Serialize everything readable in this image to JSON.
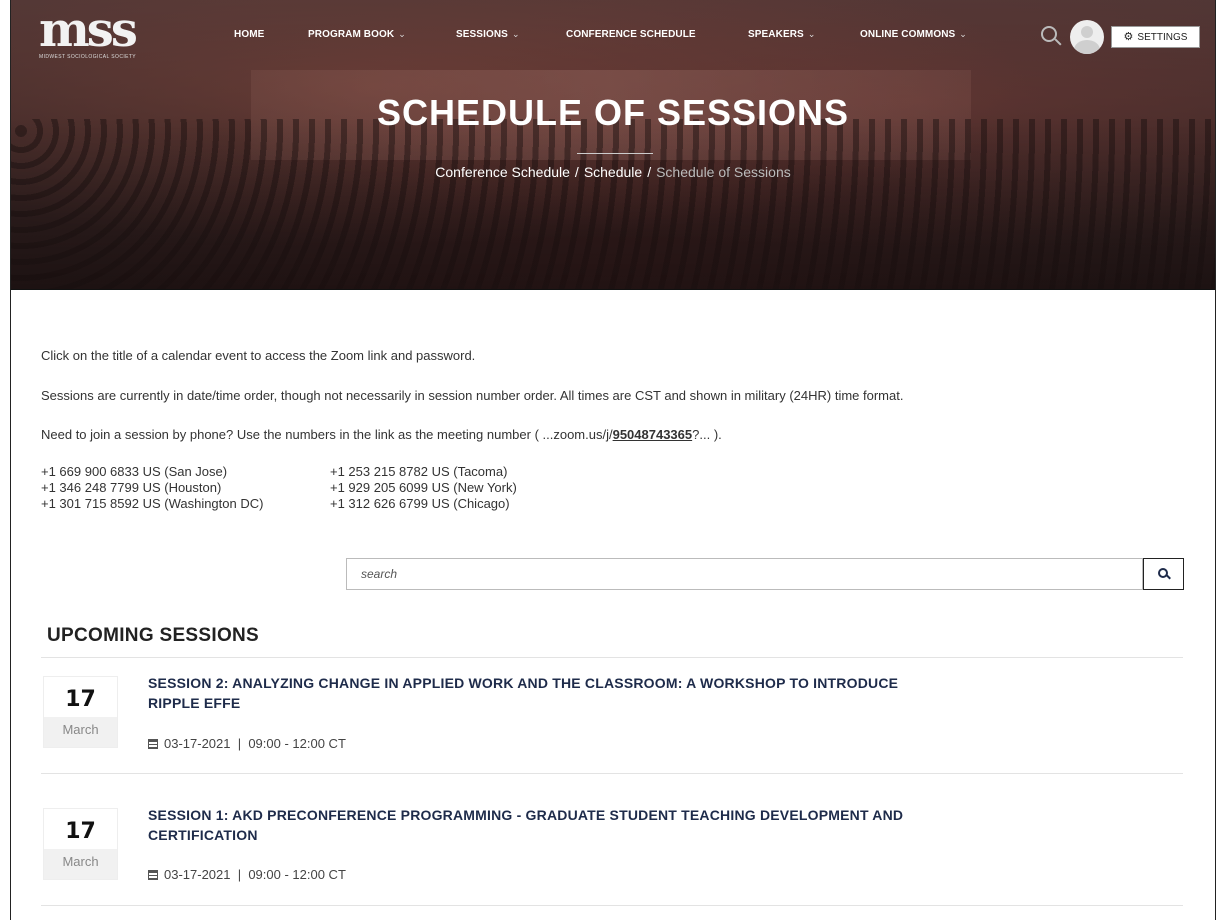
{
  "header": {
    "logo_text": "mss",
    "logo_subtext": "MIDWEST SOCIOLOGICAL SOCIETY",
    "nav": [
      {
        "label": "HOME",
        "has_caret": false
      },
      {
        "label": "PROGRAM BOOK",
        "has_caret": true
      },
      {
        "label": "SESSIONS",
        "has_caret": true
      },
      {
        "label": "CONFERENCE SCHEDULE",
        "has_caret": false
      },
      {
        "label": "SPEAKERS",
        "has_caret": true
      },
      {
        "label": "ONLINE COMMONS",
        "has_caret": true
      }
    ],
    "settings_label": "SETTINGS",
    "icons": {
      "search": "search-icon",
      "avatar": "user-avatar",
      "settings": "gear-icon"
    }
  },
  "hero": {
    "title": "SCHEDULE OF SESSIONS",
    "breadcrumb": [
      "Conference Schedule",
      "Schedule",
      "Schedule of Sessions"
    ],
    "breadcrumb_separator": "/"
  },
  "intro": {
    "line1": "Click on the title of a calendar event to access the Zoom link and password.",
    "line2": "Sessions are currently in date/time order, though not necessarily in session number order. All times are CST and shown in military (24HR) time format.",
    "line3_prefix": "Need to join a session by phone? Use the numbers in the link as the meeting number ( ",
    "line3_link_pre": "...zoom.us/j/",
    "line3_link_bold": "95048743365",
    "line3_link_post": "?...",
    "line3_suffix": " )."
  },
  "phones": {
    "left": [
      "+1 669 900 6833 US (San Jose)",
      "+1 346 248 7799 US (Houston)",
      "+1 301 715 8592 US (Washington DC)"
    ],
    "right": [
      "+1 253 215 8782 US (Tacoma)",
      "+1 929 205 6099 US (New York)",
      "+1 312 626 6799 US (Chicago)"
    ]
  },
  "search": {
    "placeholder": "search"
  },
  "upcoming": {
    "heading": "UPCOMING SESSIONS",
    "events": [
      {
        "day": "17",
        "month": "March",
        "title_line1": "SESSION 2: ANALYZING CHANGE IN APPLIED WORK AND THE CLASSROOM: A WORKSHOP TO INTRODUCE",
        "title_line2": "RIPPLE EFFE",
        "meta": "03-17-2021  |  09:00 - 12:00 CT"
      },
      {
        "day": "17",
        "month": "March",
        "title_line1": "SESSION 1: AKD PRECONFERENCE PROGRAMMING - GRADUATE STUDENT TEACHING DEVELOPMENT AND",
        "title_line2": "CERTIFICATION",
        "meta": "03-17-2021  |  09:00 - 12:00 CT"
      }
    ]
  }
}
